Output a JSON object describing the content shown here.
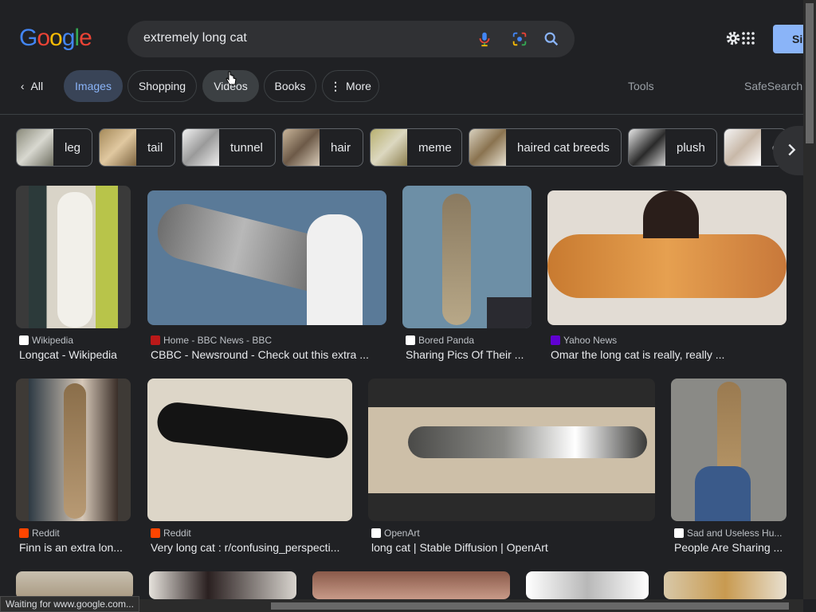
{
  "logo": "Google",
  "search": {
    "query": "extremely long cat",
    "signin_label": "Si"
  },
  "tabs": [
    {
      "label": "All"
    },
    {
      "label": "Images"
    },
    {
      "label": "Shopping"
    },
    {
      "label": "Videos"
    },
    {
      "label": "Books"
    },
    {
      "label": "More"
    }
  ],
  "tools_label": "Tools",
  "safesearch_label": "SafeSearch",
  "chips": [
    {
      "label": "leg"
    },
    {
      "label": "tail"
    },
    {
      "label": "tunnel"
    },
    {
      "label": "hair"
    },
    {
      "label": "meme"
    },
    {
      "label": "haired cat breeds"
    },
    {
      "label": "plush"
    },
    {
      "label": "c"
    }
  ],
  "results": [
    {
      "source": "Wikipedia",
      "title": "Longcat - Wikipedia",
      "fav_color": "#ffffff"
    },
    {
      "source": "Home - BBC News - BBC",
      "title": "CBBC - Newsround - Check out this extra ...",
      "fav_color": "#bb1919"
    },
    {
      "source": "Bored Panda",
      "title": "Sharing Pics Of Their ...",
      "fav_color": "#ffffff"
    },
    {
      "source": "Yahoo News",
      "title": "Omar the long cat is really, really ...",
      "fav_color": "#6001d2"
    },
    {
      "source": "Reddit",
      "title": "Finn is an extra lon...",
      "fav_color": "#ff4500"
    },
    {
      "source": "Reddit",
      "title": "Very long cat : r/confusing_perspecti...",
      "fav_color": "#ff4500"
    },
    {
      "source": "OpenArt",
      "title": "long cat | Stable Diffusion | OpenArt",
      "fav_color": "#ffffff"
    },
    {
      "source": "Sad and Useless Hu...",
      "title": "People Are Sharing ...",
      "fav_color": "#ffffff"
    }
  ],
  "status_text": "Waiting for www.google.com...",
  "colors": {
    "background": "#202124",
    "accent": "#8ab4f8",
    "active_tab": "#394457"
  }
}
